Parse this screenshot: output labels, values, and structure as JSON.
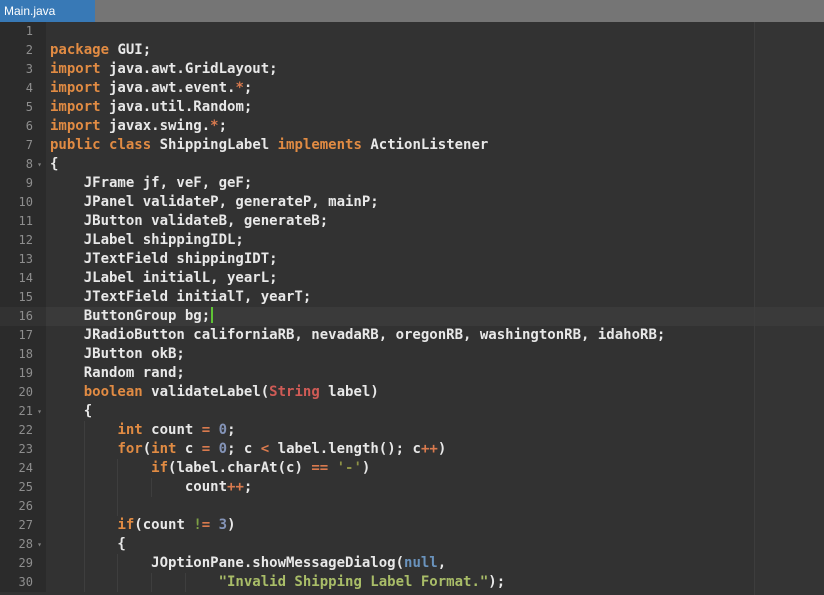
{
  "tab": {
    "title": "Main.java"
  },
  "colors": {
    "tabbar_bg": "#757575",
    "tab_bg": "#3879b6",
    "tab_text": "#ffffff",
    "editor_bg": "#323232",
    "gutter_bg": "#2b2b2b",
    "current_line": "#3a3a3a",
    "line_number": "#8e8e8e",
    "fold": "#828282",
    "text": "#e8e8e8",
    "keyword": "#e18b43",
    "operator": "#d97a4e",
    "type": "#cf5b56",
    "string": "#a9bd68",
    "char_literal": "#8f9346",
    "number": "#8494b8",
    "null_kw": "#6a93bd",
    "bang": "#7da045",
    "cursor": "#5fc335",
    "guide": "#3e3e3e",
    "ruler": "#3d3d3d"
  },
  "editor": {
    "lines": [
      {
        "n": 1,
        "segs": []
      },
      {
        "n": 2,
        "segs": [
          {
            "t": "package",
            "c": "kw"
          },
          {
            "t": " GUI;",
            "c": "pl"
          }
        ]
      },
      {
        "n": 3,
        "segs": [
          {
            "t": "import",
            "c": "kw"
          },
          {
            "t": " java.awt.GridLayout;",
            "c": "pl"
          }
        ]
      },
      {
        "n": 4,
        "segs": [
          {
            "t": "import",
            "c": "kw"
          },
          {
            "t": " java.awt.event.",
            "c": "pl"
          },
          {
            "t": "*",
            "c": "op"
          },
          {
            "t": ";",
            "c": "pl"
          }
        ]
      },
      {
        "n": 5,
        "segs": [
          {
            "t": "import",
            "c": "kw"
          },
          {
            "t": " java.util.Random;",
            "c": "pl"
          }
        ]
      },
      {
        "n": 6,
        "segs": [
          {
            "t": "import",
            "c": "kw"
          },
          {
            "t": " javax.swing.",
            "c": "pl"
          },
          {
            "t": "*",
            "c": "op"
          },
          {
            "t": ";",
            "c": "pl"
          }
        ]
      },
      {
        "n": 7,
        "segs": [
          {
            "t": "public",
            "c": "kw"
          },
          {
            "t": " ",
            "c": "pl"
          },
          {
            "t": "class",
            "c": "kw"
          },
          {
            "t": " ShippingLabel ",
            "c": "pl"
          },
          {
            "t": "implements",
            "c": "kw"
          },
          {
            "t": " ActionListener",
            "c": "pl"
          }
        ]
      },
      {
        "n": 8,
        "fold": true,
        "segs": [
          {
            "t": "{",
            "c": "pl"
          }
        ]
      },
      {
        "n": 9,
        "segs": [
          {
            "t": "    JFrame jf, veF, geF;",
            "c": "pl"
          }
        ]
      },
      {
        "n": 10,
        "segs": [
          {
            "t": "    JPanel validateP, generateP, mainP;",
            "c": "pl"
          }
        ]
      },
      {
        "n": 11,
        "segs": [
          {
            "t": "    JButton validateB, generateB;",
            "c": "pl"
          }
        ]
      },
      {
        "n": 12,
        "segs": [
          {
            "t": "    JLabel shippingIDL;",
            "c": "pl"
          }
        ]
      },
      {
        "n": 13,
        "segs": [
          {
            "t": "    JTextField shippingIDT;",
            "c": "pl"
          }
        ]
      },
      {
        "n": 14,
        "segs": [
          {
            "t": "    JLabel initialL, yearL;",
            "c": "pl"
          }
        ]
      },
      {
        "n": 15,
        "segs": [
          {
            "t": "    JTextField initialT, yearT;",
            "c": "pl"
          }
        ]
      },
      {
        "n": 16,
        "current": true,
        "cursor": true,
        "segs": [
          {
            "t": "    ButtonGroup bg;",
            "c": "pl"
          }
        ]
      },
      {
        "n": 17,
        "segs": [
          {
            "t": "    JRadioButton californiaRB, nevadaRB, oregonRB, washingtonRB, idahoRB;",
            "c": "pl"
          }
        ]
      },
      {
        "n": 18,
        "segs": [
          {
            "t": "    JButton okB;",
            "c": "pl"
          }
        ]
      },
      {
        "n": 19,
        "segs": [
          {
            "t": "    Random rand;",
            "c": "pl"
          }
        ]
      },
      {
        "n": 20,
        "segs": [
          {
            "t": "    ",
            "c": "pl"
          },
          {
            "t": "boolean",
            "c": "kw"
          },
          {
            "t": " validateLabel(",
            "c": "pl"
          },
          {
            "t": "String",
            "c": "ty"
          },
          {
            "t": " label)",
            "c": "pl"
          }
        ]
      },
      {
        "n": 21,
        "fold": true,
        "segs": [
          {
            "t": "    {",
            "c": "pl"
          }
        ]
      },
      {
        "n": 22,
        "segs": [
          {
            "t": "        ",
            "c": "pl"
          },
          {
            "t": "int",
            "c": "kw"
          },
          {
            "t": " count ",
            "c": "pl"
          },
          {
            "t": "=",
            "c": "op"
          },
          {
            "t": " ",
            "c": "pl"
          },
          {
            "t": "0",
            "c": "nu"
          },
          {
            "t": ";",
            "c": "pl"
          }
        ]
      },
      {
        "n": 23,
        "segs": [
          {
            "t": "        ",
            "c": "pl"
          },
          {
            "t": "for",
            "c": "kw"
          },
          {
            "t": "(",
            "c": "pl"
          },
          {
            "t": "int",
            "c": "kw"
          },
          {
            "t": " c ",
            "c": "pl"
          },
          {
            "t": "=",
            "c": "op"
          },
          {
            "t": " ",
            "c": "pl"
          },
          {
            "t": "0",
            "c": "nu"
          },
          {
            "t": "; c ",
            "c": "pl"
          },
          {
            "t": "<",
            "c": "op"
          },
          {
            "t": " label.length(); c",
            "c": "pl"
          },
          {
            "t": "++",
            "c": "op"
          },
          {
            "t": ")",
            "c": "pl"
          }
        ]
      },
      {
        "n": 24,
        "segs": [
          {
            "t": "            ",
            "c": "pl"
          },
          {
            "t": "if",
            "c": "kw"
          },
          {
            "t": "(label.charAt(c) ",
            "c": "pl"
          },
          {
            "t": "==",
            "c": "op"
          },
          {
            "t": " ",
            "c": "pl"
          },
          {
            "t": "'-'",
            "c": "ch"
          },
          {
            "t": ")",
            "c": "pl"
          }
        ]
      },
      {
        "n": 25,
        "segs": [
          {
            "t": "                count",
            "c": "pl"
          },
          {
            "t": "++",
            "c": "op"
          },
          {
            "t": ";",
            "c": "pl"
          }
        ]
      },
      {
        "n": 26,
        "indent_hint": 12,
        "segs": []
      },
      {
        "n": 27,
        "segs": [
          {
            "t": "        ",
            "c": "pl"
          },
          {
            "t": "if",
            "c": "kw"
          },
          {
            "t": "(count ",
            "c": "pl"
          },
          {
            "t": "!",
            "c": "bang"
          },
          {
            "t": "=",
            "c": "op"
          },
          {
            "t": " ",
            "c": "pl"
          },
          {
            "t": "3",
            "c": "nu"
          },
          {
            "t": ")",
            "c": "pl"
          }
        ]
      },
      {
        "n": 28,
        "fold": true,
        "segs": [
          {
            "t": "        {",
            "c": "pl"
          }
        ]
      },
      {
        "n": 29,
        "segs": [
          {
            "t": "            JOptionPane.showMessageDialog(",
            "c": "pl"
          },
          {
            "t": "null",
            "c": "nl"
          },
          {
            "t": ",",
            "c": "pl"
          }
        ]
      },
      {
        "n": 30,
        "segs": [
          {
            "t": "                    ",
            "c": "pl"
          },
          {
            "t": "\"Invalid Shipping Label Format.\"",
            "c": "st"
          },
          {
            "t": ");",
            "c": "pl"
          }
        ]
      }
    ]
  },
  "icons": {
    "fold_arrow": "▾"
  }
}
